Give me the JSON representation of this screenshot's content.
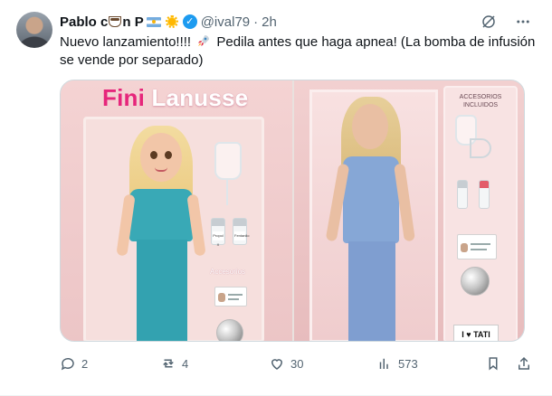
{
  "tweet": {
    "author": {
      "name_prefix": "Pablo c",
      "name_suffix": "n P",
      "handle": "@ival79",
      "time": "2h",
      "verified": true,
      "avatar_icon": "avatar-photo"
    },
    "text_part1": "Nuevo lanzamiento!!!!",
    "text_part2": "Pedila antes que haga apnea! (La bomba de infusión se vende por separado)",
    "media": {
      "left_box_title_1": "Fini",
      "left_box_title_2": "Lanusse",
      "left_accessories_label": "Accesorios",
      "left_vial_1": "Propol X",
      "left_vial_2": "Fentanilo",
      "right_accessories_title": "ACCESORIOS INCLUIDOS",
      "right_sign": "I ♥ TATI"
    },
    "actions": {
      "replies": "2",
      "reposts": "4",
      "likes": "30",
      "views": "573"
    },
    "colors": {
      "accent": "#1d9bf0",
      "muted": "#536471",
      "brand_pink": "#e6267b"
    }
  }
}
